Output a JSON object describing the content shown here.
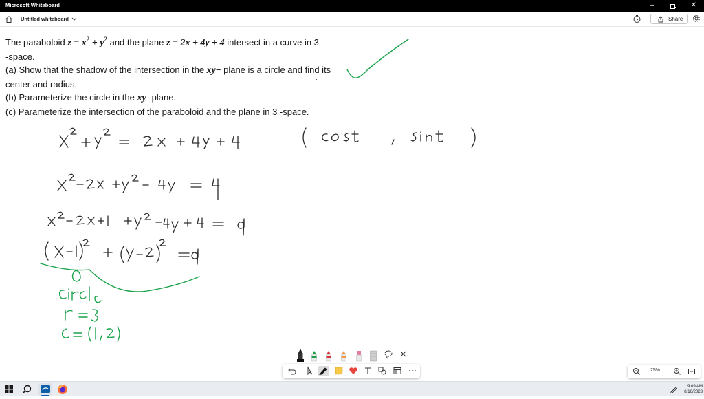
{
  "window": {
    "app_title": "Microsoft Whiteboard",
    "controls": [
      "minimize",
      "restore",
      "close"
    ]
  },
  "toolbar": {
    "doc_title": "Untitled whiteboard",
    "share_label": "Share",
    "icons": [
      "home-icon",
      "chevron-down-icon",
      "timer-icon",
      "share-icon",
      "gear-icon"
    ]
  },
  "problem": {
    "l1_a": "The paraboloid ",
    "l1_b": " and the plane ",
    "l1_c": " intersect in a curve in 3",
    "l2": "-space.",
    "l3_a": "(a) Show that the shadow of the intersection in the ",
    "l3_b": "− plane is a circle and find its",
    "l4": "center and radius.",
    "l5_a": "(b) Parameterize the circle in the ",
    "l5_b": " -plane.",
    "l6": "(c) Parameterize the intersection of the paraboloid and the plane in 3 -space.",
    "eq_paraboloid": {
      "lhs": "z = x",
      "mid": " + y",
      "exp": "2"
    },
    "eq_plane": "z = 2x + 4y + 4",
    "xy": "xy"
  },
  "handwriting": {
    "line1": "x² + y² = 2x + 4y + 4",
    "line2": "x² − 2x + y² − 4y = 4",
    "line3": "x² − 2x + 1 + y² − 4y + 4 = 9",
    "line4": "(x−1)² + (y−2)² = 9",
    "param": "( cos t , sin t )",
    "word_circle": "circle",
    "radius": "r = 3",
    "center": "c = (1,2)",
    "ink_colors": {
      "black": "#2b2b2b",
      "green": "#1aa34a"
    }
  },
  "ink_palette": {
    "pens": [
      {
        "name": "black-pen",
        "color": "#222222"
      },
      {
        "name": "green-pen",
        "color": "#1e9e4a"
      },
      {
        "name": "red-pen",
        "color": "#d13438"
      },
      {
        "name": "orange-pen",
        "color": "#f2994a"
      },
      {
        "name": "pink-pen",
        "color": "#e67ca0"
      },
      {
        "name": "highlighter",
        "color": "#bdbdbd"
      }
    ],
    "extra_icons": [
      "lasso-icon",
      "close-icon"
    ]
  },
  "bottom_toolbar": {
    "tools": [
      "undo-icon",
      "select-icon",
      "pen-icon",
      "sticky-note-icon",
      "reaction-icon",
      "text-icon",
      "shapes-icon",
      "templates-icon",
      "more-icon"
    ]
  },
  "zoom": {
    "level": "25%"
  },
  "taskbar": {
    "time": "9:09 AM",
    "date": "8/16/2023"
  }
}
